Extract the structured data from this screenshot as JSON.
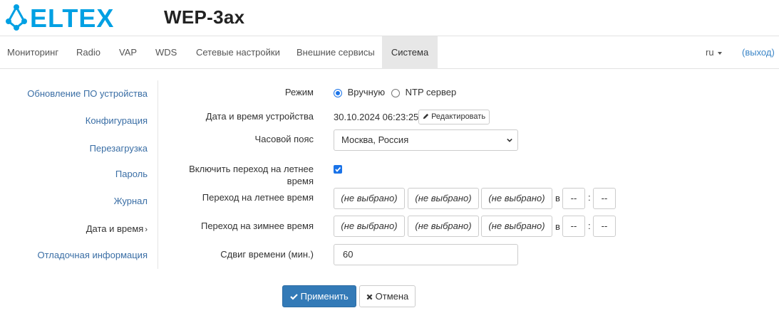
{
  "header": {
    "logo_text": "ELTEX",
    "device_title": "WEP-3ax",
    "brand_color": "#00a0e3"
  },
  "nav": {
    "items": [
      {
        "label": "Мониторинг"
      },
      {
        "label": "Radio"
      },
      {
        "label": "VAP"
      },
      {
        "label": "WDS"
      },
      {
        "label": "Сетевые настройки"
      },
      {
        "label": "Внешние сервисы"
      },
      {
        "label": "Система",
        "active": true
      }
    ],
    "lang": "ru",
    "logout": "(выход)"
  },
  "sidebar": {
    "items": [
      {
        "label": "Обновление ПО устройства"
      },
      {
        "label": "Конфигурация"
      },
      {
        "label": "Перезагрузка"
      },
      {
        "label": "Пароль"
      },
      {
        "label": "Журнал"
      },
      {
        "label": "Дата и время",
        "active": true,
        "chevron": "›"
      },
      {
        "label": "Отладочная информация"
      }
    ]
  },
  "form": {
    "mode_label": "Режим",
    "mode_manual": "Вручную",
    "mode_ntp": "NTP сервер",
    "datetime_label": "Дата и время устройства",
    "datetime_value": "30.10.2024 06:23:25",
    "edit_button": "Редактировать",
    "timezone_label": "Часовой пояс",
    "timezone_value": "Москва, Россия",
    "dst_label": "Включить переход на летнее время",
    "dst_enabled": true,
    "summer_label": "Переход на летнее время",
    "winter_label": "Переход на зимнее время",
    "not_selected": "(не выбрано)",
    "at_label": "в",
    "time_sep": ":",
    "dash": "--",
    "offset_label": "Сдвиг времени (мин.)",
    "offset_value": "60"
  },
  "actions": {
    "apply": "Применить",
    "cancel": "Отмена"
  }
}
